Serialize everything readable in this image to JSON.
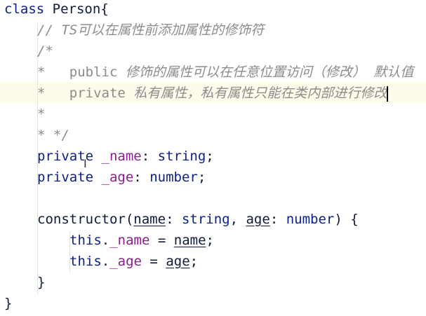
{
  "code": {
    "class_kw": "class",
    "class_name": "Person",
    "open_brace": "{",
    "comment_ts": "// TS可以在属性前添加属性的修饰符",
    "comment_open": "/*",
    "star": "*",
    "public_kw": "public",
    "public_desc": "修饰的属性可以在任意位置访问（修改） 默认值",
    "private_kw": "private",
    "private_desc": "私有属性，私有属性只能在类内部进行修改",
    "comment_close": "* */",
    "name_field": "_name",
    "age_field": "_age",
    "string_type": "string",
    "number_type": "number",
    "constructor_kw": "constructor",
    "param_name": "name",
    "param_age": "age",
    "this_kw": "this",
    "close_brace": "}"
  }
}
